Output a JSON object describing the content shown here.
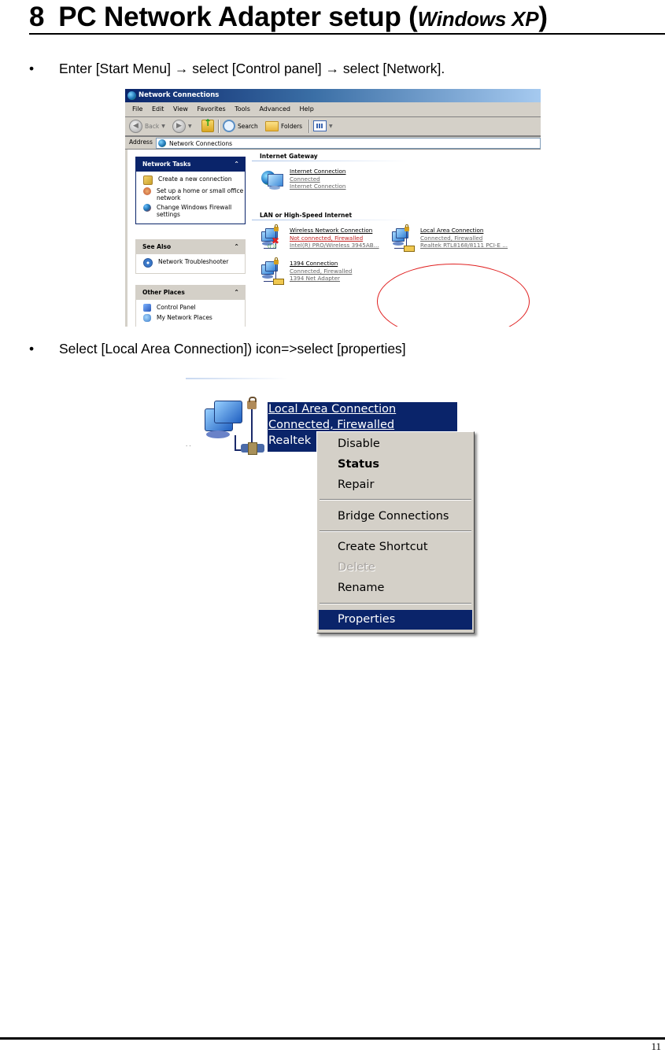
{
  "heading": {
    "number": "8",
    "title": "PC Network Adapter setup (",
    "os": "Windows XP",
    "close": ")"
  },
  "steps": [
    {
      "bullet": "•",
      "text": "Enter [Start Menu] → select [Control panel] → select [Network]."
    },
    {
      "bullet": "•",
      "text": "Select [Local Area Connection]) icon=>select [properties]"
    }
  ],
  "window": {
    "title": "Network Connections",
    "menu": [
      "File",
      "Edit",
      "View",
      "Favorites",
      "Tools",
      "Advanced",
      "Help"
    ],
    "toolbar": {
      "back": "Back",
      "search": "Search",
      "folders": "Folders"
    },
    "address": {
      "label": "Address",
      "value": "Network Connections"
    },
    "left_pane": {
      "network_tasks": {
        "title": "Network Tasks",
        "items": [
          "Create a new connection",
          "Set up a home or small office network",
          "Change Windows Firewall settings"
        ]
      },
      "see_also": {
        "title": "See Also",
        "items": [
          "Network Troubleshooter"
        ]
      },
      "other_places": {
        "title": "Other Places",
        "items": [
          "Control Panel",
          "My Network Places"
        ]
      }
    },
    "groups": [
      {
        "title": "Internet Gateway",
        "connections": [
          {
            "name": "Internet Connection",
            "status": "Connected",
            "device": "Internet Connection"
          }
        ]
      },
      {
        "title": "LAN or High-Speed Internet",
        "connections": [
          {
            "name": "Wireless Network Connection",
            "status": "Not connected, Firewalled",
            "device": "Intel(R) PRO/Wireless 3945AB..."
          },
          {
            "name": "Local Area Connection",
            "status": "Connected, Firewalled",
            "device": "Realtek RTL8168/8111 PCI-E ..."
          },
          {
            "name": "1394 Connection",
            "status": "Connected, Firewalled",
            "device": "1394 Net Adapter"
          }
        ]
      }
    ]
  },
  "context_shot": {
    "selected": {
      "name": "Local Area Connection",
      "status": "Connected, Firewalled",
      "device": "Realtek"
    },
    "menu": [
      {
        "label": "Disable",
        "style": "normal"
      },
      {
        "label": "Status",
        "style": "bold"
      },
      {
        "label": "Repair",
        "style": "normal"
      },
      {
        "label": "Bridge Connections",
        "style": "normal"
      },
      {
        "label": "Create Shortcut",
        "style": "normal"
      },
      {
        "label": "Delete",
        "style": "disabled"
      },
      {
        "label": "Rename",
        "style": "normal"
      },
      {
        "label": "Properties",
        "style": "selected"
      }
    ]
  },
  "footer": {
    "page_number": "11"
  },
  "colors": {
    "xp_selection": "#0a246a",
    "menu_face": "#d4d0c8",
    "highlight_circle": "#e02020"
  }
}
